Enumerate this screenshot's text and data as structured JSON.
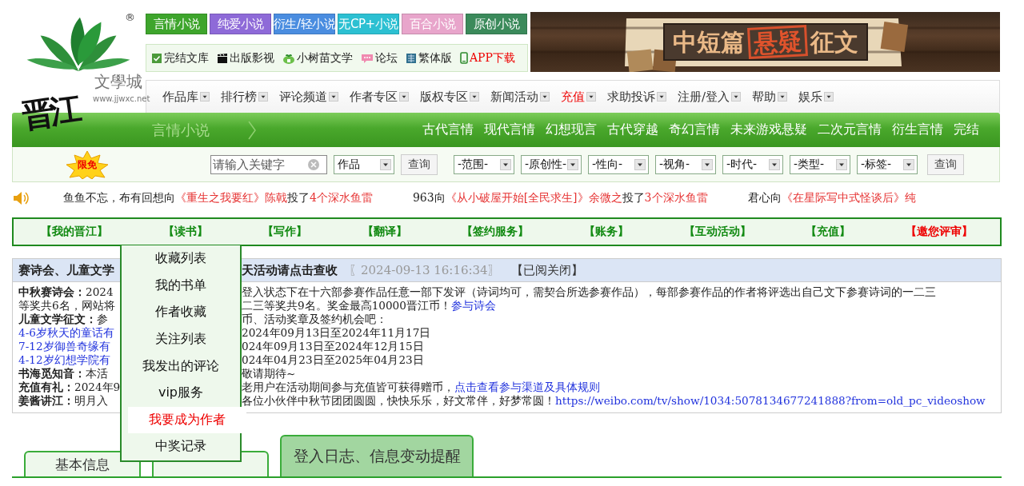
{
  "logo": {
    "name": "文學城",
    "url": "www.jjwxc.net",
    "mark": "®",
    "calligraphy": "晋江"
  },
  "channels": [
    {
      "label": "言情小说",
      "color": "#3ea52c"
    },
    {
      "label": "纯爱小说",
      "color": "#8e6ad8"
    },
    {
      "label": "衍生/轻小说",
      "color": "#4a8de0"
    },
    {
      "label": "无CP+小说",
      "color": "#2cc0d2"
    },
    {
      "label": "百合小说",
      "color": "#e8a5cb"
    },
    {
      "label": "原创小说",
      "color": "#3b8a5b"
    }
  ],
  "quick_links": [
    {
      "label": "完结文库",
      "kind": "check",
      "alert": false
    },
    {
      "label": "出版影视",
      "kind": "film",
      "alert": false
    },
    {
      "label": "小树苗文学",
      "kind": "sprout",
      "alert": false
    },
    {
      "label": "论坛",
      "kind": "chat",
      "alert": false
    },
    {
      "label": "繁体版",
      "kind": "book",
      "alert": false
    },
    {
      "label": "APP下载",
      "kind": "phone",
      "alert": true
    }
  ],
  "banner": {
    "parts": [
      {
        "text": "中短篇",
        "stamped": false
      },
      {
        "text": "悬疑",
        "stamped": true
      },
      {
        "text": "征文",
        "stamped": false
      }
    ]
  },
  "nav_menu": [
    {
      "label": "作品库",
      "alert": false
    },
    {
      "label": "排行榜",
      "alert": false
    },
    {
      "label": "评论频道",
      "alert": false
    },
    {
      "label": "作者专区",
      "alert": false
    },
    {
      "label": "版权专区",
      "alert": false
    },
    {
      "label": "新闻活动",
      "alert": false
    },
    {
      "label": "充值",
      "alert": true
    },
    {
      "label": "求助投诉",
      "alert": false
    },
    {
      "label": "注册/登入",
      "alert": false
    },
    {
      "label": "帮助",
      "alert": false
    },
    {
      "label": "娱乐",
      "alert": false
    }
  ],
  "genre_bar": {
    "title": "言情小说",
    "links": [
      "古代言情",
      "现代言情",
      "幻想现言",
      "古代穿越",
      "奇幻言情",
      "未来游戏悬疑",
      "二次元言情",
      "衍生言情",
      "完结"
    ]
  },
  "search": {
    "badge": "限免",
    "placeholder": "请输入关键字",
    "scope": "作品",
    "button": "查询",
    "filters": [
      "-范围-",
      "-原创性-",
      "-性向-",
      "-视角-",
      "-时代-",
      "-类型-",
      "-标签-"
    ],
    "filter_button": "查询"
  },
  "ticker": [
    {
      "segments": [
        {
          "text": "鱼鱼不忘，布有回想向",
          "kind": "plain"
        },
        {
          "text": "《重生之我要红》陈戟",
          "kind": "red"
        },
        {
          "text": "投了",
          "kind": "plain"
        },
        {
          "text": "4个深水鱼雷",
          "kind": "red"
        }
      ]
    },
    {
      "segments": [
        {
          "text": "963向",
          "kind": "plain"
        },
        {
          "text": "《从小破屋开始[全民求生]》余微之",
          "kind": "red"
        },
        {
          "text": "投了",
          "kind": "plain"
        },
        {
          "text": "3个深水鱼雷",
          "kind": "red"
        }
      ]
    },
    {
      "segments": [
        {
          "text": "君心向",
          "kind": "plain"
        },
        {
          "text": "《在星际写中式怪谈后》纯",
          "kind": "red"
        }
      ]
    }
  ],
  "account_nav": [
    {
      "label": "【我的晋江】",
      "alert": false
    },
    {
      "label": "【读书】",
      "alert": false
    },
    {
      "label": "【写作】",
      "alert": false
    },
    {
      "label": "【翻译】",
      "alert": false
    },
    {
      "label": "【签约服务】",
      "alert": false
    },
    {
      "label": "【账务】",
      "alert": false
    },
    {
      "label": "【互动活动】",
      "alert": false
    },
    {
      "label": "【充值】",
      "alert": false
    },
    {
      "label": "【邀您评审】",
      "alert": true
    }
  ],
  "reading_menu": [
    {
      "label": "收藏列表",
      "selected": false
    },
    {
      "label": "我的书单",
      "selected": false
    },
    {
      "label": "作者收藏",
      "selected": false
    },
    {
      "label": "关注列表",
      "selected": false
    },
    {
      "label": "我发出的评论",
      "selected": false
    },
    {
      "label": "vip服务",
      "selected": false
    },
    {
      "label": "我要成为作者",
      "selected": true
    },
    {
      "label": "中奖记录",
      "selected": false
    }
  ],
  "notice": {
    "title_parts": [
      "赛诗会、儿童文学",
      "天活动请点击查收"
    ],
    "time": "〖2024-09-13 16:16:34〗",
    "close": "【已阅关闭】",
    "lines": [
      {
        "left": [
          {
            "text": "中秋赛诗会：",
            "kind": "label"
          },
          {
            "text": "2024",
            "kind": "plain"
          }
        ],
        "right": [
          {
            "text": "登入状态下在十六部参赛作品任意一部下发评（诗词均可，需契合所选参赛作品），每部参赛作品的作者将评选出自己文下参赛诗词的一二三",
            "kind": "plain"
          }
        ]
      },
      {
        "left": [
          {
            "text": "等奖共6名，网站将",
            "kind": "plain"
          }
        ],
        "right": [
          {
            "text": "二三等奖共9名。奖金最高10000晋江币！",
            "kind": "plain"
          },
          {
            "text": "参与诗会",
            "kind": "link"
          }
        ]
      },
      {
        "left": [
          {
            "text": "儿童文学征文：",
            "kind": "label"
          },
          {
            "text": "参",
            "kind": "plain"
          }
        ],
        "right": [
          {
            "text": "币、活动奖章及签约机会吧：",
            "kind": "plain"
          }
        ]
      },
      {
        "left": [
          {
            "text": "4-6岁秋天的童话有",
            "kind": "link"
          }
        ],
        "right": [
          {
            "text": "2024年09月13日至2024年11月17日",
            "kind": "plain"
          }
        ]
      },
      {
        "left": [
          {
            "text": "7-12岁御兽奇缘有",
            "kind": "link"
          }
        ],
        "right": [
          {
            "text": "024年09月13日至2024年12月15日",
            "kind": "plain"
          }
        ]
      },
      {
        "left": [
          {
            "text": "4-12岁幻想学院有",
            "kind": "link"
          }
        ],
        "right": [
          {
            "text": "024年04月23日至2025年04月23日",
            "kind": "plain"
          }
        ]
      },
      {
        "left": [
          {
            "text": "书海觅知音：",
            "kind": "label"
          },
          {
            "text": "本活",
            "kind": "plain"
          }
        ],
        "right": [
          {
            "text": "敬请期待~",
            "kind": "plain"
          }
        ]
      },
      {
        "left": [
          {
            "text": "充值有礼：",
            "kind": "label"
          },
          {
            "text": "2024年9",
            "kind": "plain"
          }
        ],
        "right": [
          {
            "text": "老用户在活动期间参与充值皆可获得赠币，",
            "kind": "plain"
          },
          {
            "text": "点击查看参与渠道及具体规则",
            "kind": "link"
          }
        ]
      },
      {
        "left": [
          {
            "text": "姜酱讲江：",
            "kind": "label"
          },
          {
            "text": "明月入",
            "kind": "plain"
          }
        ],
        "right": [
          {
            "text": "各位小伙伴中秋节团团圆圆，快快乐乐，好文常伴，好梦常圆！",
            "kind": "plain"
          },
          {
            "text": "https://weibo.com/tv/show/1034:5078134677241888?from=old_pc_videoshow",
            "kind": "link"
          }
        ]
      }
    ]
  },
  "tabs": [
    {
      "label": "基本信息",
      "selected": false
    },
    {
      "selected": false
    },
    {
      "label": "登入日志、信息变动提醒",
      "selected": true
    }
  ]
}
